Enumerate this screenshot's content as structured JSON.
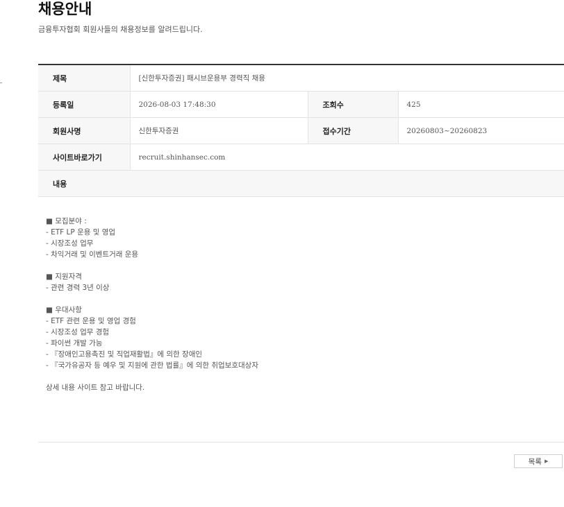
{
  "header": {
    "title": "채용안내",
    "subtitle": "금융투자협회 회원사들의 채용정보를 알려드립니다."
  },
  "info": {
    "title_label": "제목",
    "title_value": "[신한투자증권] 패시브운용부 경력직 채용",
    "date_label": "등록일",
    "date_value": "2026-08-03 17:48:30",
    "views_label": "조회수",
    "views_value": "425",
    "company_label": "회원사명",
    "company_value": "신한투자증권",
    "period_label": "접수기간",
    "period_value": "20260803~20260823",
    "site_label": "사이트바로가기",
    "site_value": "recruit.shinhansec.com",
    "content_label": "내용"
  },
  "content": {
    "lines": [
      "■ 모집분야 :",
      "- ETF LP 운용 및 영업",
      "- 시장조성 업무",
      "- 차익거래 및 이벤트거래 운용",
      "",
      "■ 지원자격",
      "- 관련 경력 3년 이상",
      "",
      "■ 우대사항",
      "- ETF 관련 운용 및 영업 경험",
      "- 시장조성 업무 경험",
      "- 파이썬 개발 가능",
      "- 『장애인고용촉진 및 직업재활법』에 의한 장애인",
      "- 『국가유공자 등 예우 및 지원에 관한 법률』에 의한 취업보호대상자",
      "",
      "상세 내용 사이트 참고 바랍니다."
    ]
  },
  "footer": {
    "list_button_label": "목록",
    "list_button_icon": "triangle-right-icon"
  }
}
